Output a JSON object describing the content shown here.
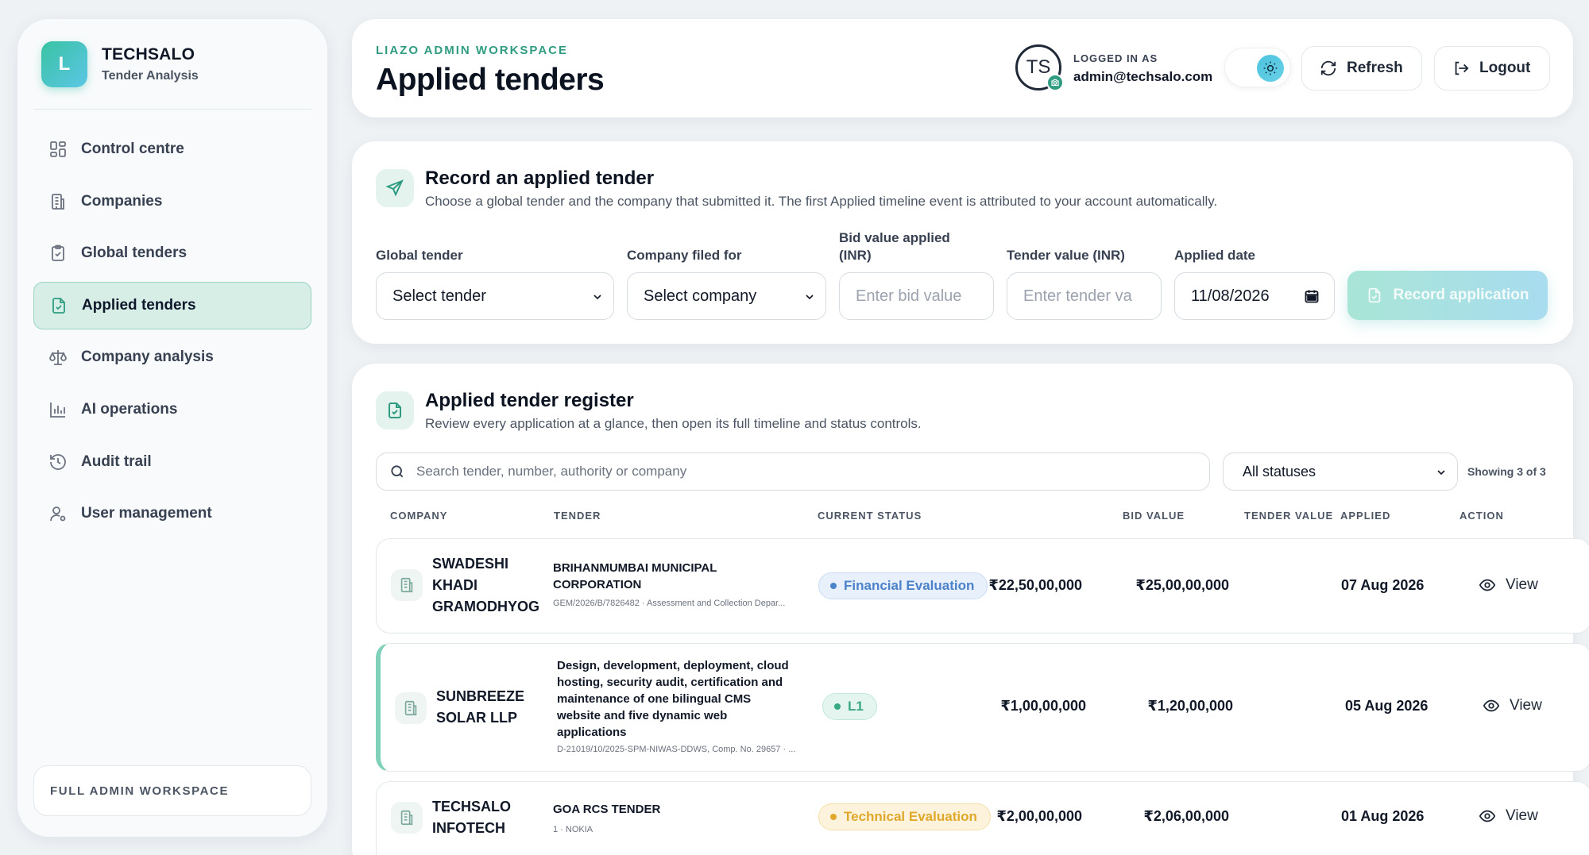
{
  "brand": {
    "logo_letter": "L",
    "name": "TECHSALO",
    "subtitle": "Tender Analysis"
  },
  "sidebar": {
    "items": [
      {
        "label": "Control centre",
        "icon": "grid-icon",
        "active": false
      },
      {
        "label": "Companies",
        "icon": "building-icon",
        "active": false
      },
      {
        "label": "Global tenders",
        "icon": "clipboard-check-icon",
        "active": false
      },
      {
        "label": "Applied tenders",
        "icon": "file-check-icon",
        "active": true
      },
      {
        "label": "Company analysis",
        "icon": "scale-icon",
        "active": false
      },
      {
        "label": "AI operations",
        "icon": "bar-chart-icon",
        "active": false
      },
      {
        "label": "Audit trail",
        "icon": "history-icon",
        "active": false
      },
      {
        "label": "User management",
        "icon": "user-gear-icon",
        "active": false
      }
    ],
    "workspace_label": "FULL ADMIN WORKSPACE"
  },
  "header": {
    "eyebrow": "LIAZO ADMIN WORKSPACE",
    "title": "Applied tenders",
    "avatar_initials": "TS",
    "logged_in_label": "LOGGED IN AS",
    "email": "admin@techsalo.com",
    "refresh_label": "Refresh",
    "logout_label": "Logout"
  },
  "record": {
    "title": "Record an applied tender",
    "subtitle": "Choose a global tender and the company that submitted it. The first Applied timeline event is attributed to your account automatically.",
    "global_tender_label": "Global tender",
    "global_tender_value": "Select tender",
    "company_label": "Company filed for",
    "company_value": "Select company",
    "bid_label_1": "Bid value applied",
    "bid_label_2": "(INR)",
    "bid_placeholder": "Enter bid value",
    "tender_value_label": "Tender value (INR)",
    "tender_value_placeholder": "Enter tender va",
    "date_label": "Applied date",
    "date_value": "11/08/2026",
    "button_label": "Record application"
  },
  "register": {
    "title": "Applied tender register",
    "subtitle": "Review every application at a glance, then open its full timeline and status controls.",
    "search_placeholder": "Search tender, number, authority or company",
    "status_filter": "All statuses",
    "showing": "Showing 3 of 3",
    "columns": [
      "COMPANY",
      "TENDER",
      "CURRENT STATUS",
      "BID VALUE",
      "TENDER VALUE",
      "APPLIED",
      "ACTION"
    ],
    "rows": [
      {
        "company_lines": [
          "SWADESHI",
          "KHADI",
          "GRAMODHYOG"
        ],
        "tender_lines": [
          "BRIHANMUMBAI MUNICIPAL",
          "CORPORATION"
        ],
        "tender_meta": "GEM/2026/B/7826482 · Assessment and Collection Depar...",
        "status": "Financial Evaluation",
        "bid_value": "₹22,50,00,000",
        "tender_value": "₹25,00,00,000",
        "applied": "07 Aug 2026",
        "action": "View"
      },
      {
        "company_lines": [
          "SUNBREEZE",
          "SOLAR LLP"
        ],
        "tender_lines": [
          "Design, development, deployment, cloud",
          "hosting, security audit, certification and",
          "maintenance of one bilingual CMS",
          "website and five dynamic web",
          "applications"
        ],
        "tender_meta": "D-21019/10/2025-SPM-NIWAS-DDWS, Comp. No. 29657 · ...",
        "status": "L1",
        "bid_value": "₹1,00,00,000",
        "tender_value": "₹1,20,00,000",
        "applied": "05 Aug 2026",
        "action": "View"
      },
      {
        "company_lines": [
          "TECHSALO",
          "INFOTECH"
        ],
        "tender_lines": [
          "GOA RCS TENDER"
        ],
        "tender_meta": "1 · NOKIA",
        "status": "Technical Evaluation",
        "bid_value": "₹2,00,00,000",
        "tender_value": "₹2,06,00,000",
        "applied": "01 Aug 2026",
        "action": "View"
      }
    ]
  },
  "colors": {
    "accent": "#2f9c81",
    "financial": "#4c82c9",
    "l1": "#39a884",
    "technical": "#e0a82a"
  }
}
